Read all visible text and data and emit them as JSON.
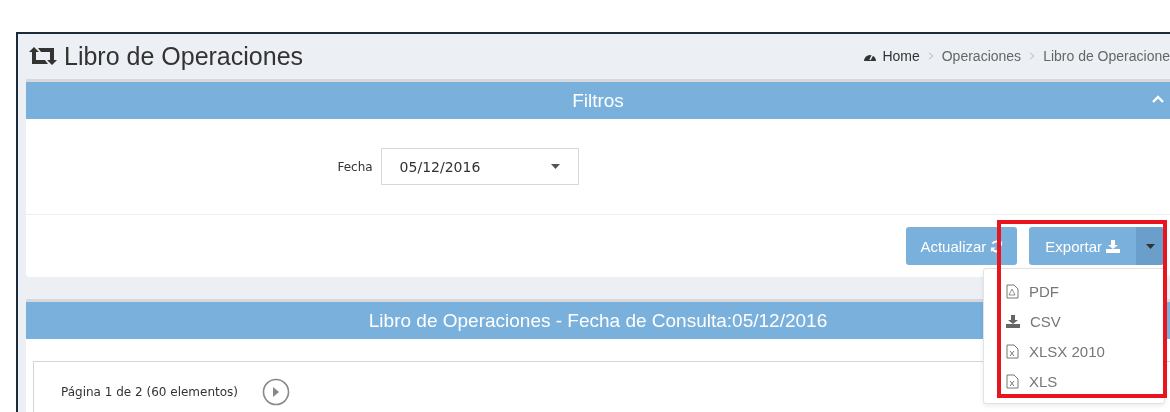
{
  "page": {
    "title": "Libro de Operaciones"
  },
  "breadcrumb": [
    {
      "label": "Home",
      "kind": "home"
    },
    {
      "label": "Operaciones",
      "kind": "link"
    },
    {
      "label": "Libro de Operacione",
      "kind": "link"
    }
  ],
  "filters_panel": {
    "title": "Filtros",
    "expanded": true,
    "fields": [
      {
        "label": "Fecha",
        "value": "05/12/2016"
      }
    ],
    "refresh_button": "Actualizar",
    "export_button": "Exportar",
    "export_highlighted": true,
    "export_menu": [
      {
        "label": "PDF",
        "kind": "pdf"
      },
      {
        "label": "CSV",
        "kind": "download"
      },
      {
        "label": "XLSX 2010",
        "kind": "excel"
      },
      {
        "label": "XLS",
        "kind": "excel"
      }
    ]
  },
  "results_panel": {
    "title": "Libro de Operaciones - Fecha de Consulta:05/12/2016",
    "pager": "Página 1 de 2 (60 elementos)"
  }
}
